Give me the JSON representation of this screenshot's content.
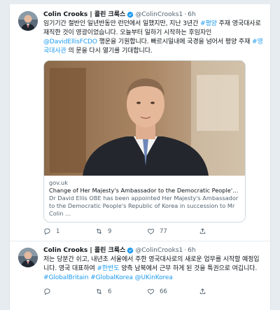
{
  "tweets": [
    {
      "name": "Colin Crooks | 콜린 크룩스",
      "handle": "@ColinCrooks1",
      "separator": "·",
      "time": "6h",
      "text_parts": [
        {
          "t": "임기기간 절반인 일년반동안 런던에서 일했지만, 지난 3년간 ",
          "link": false
        },
        {
          "t": "#평양",
          "link": true
        },
        {
          "t": " 주재 영국대사로 재직한 것이 영광이었습니다. 오늘부터 일하기 시작하는 후임자인 ",
          "link": false
        },
        {
          "t": "@DavidEllisFCDO",
          "link": true
        },
        {
          "t": " 행운을 기원합니다. 빠르시일내에 국경을 넘어서 평양 주재 ",
          "link": false
        },
        {
          "t": "#영국대사관",
          "link": true
        },
        {
          "t": " 의 문을 다시 열기를 기대합니다.",
          "link": false
        }
      ],
      "card": {
        "domain": "gov.uk",
        "title": "Change of Her Majesty's Ambassador to the Democratic People's Rep…",
        "description": "Dr David Ellis OBE has been appointed Her Majesty's Ambassador to the Democratic People's Republic of Korea in succession to Mr Colin …"
      },
      "actions": {
        "replies": "1",
        "retweets": "9",
        "likes": "77"
      }
    },
    {
      "name": "Colin Crooks | 콜린 크룩스",
      "handle": "@ColinCrooks1",
      "separator": "·",
      "time": "6h",
      "text_parts": [
        {
          "t": "저는 당분간 쉬고, 내년초 서울에서 주한 영국대사로의 새로운 업무를 시작할 예정입니다. 영국 대표하여 ",
          "link": false
        },
        {
          "t": "#한반도",
          "link": true
        },
        {
          "t": " 양측 남북에서 근무 하게 된 것을 특권으로 여깁니다. ",
          "link": false
        },
        {
          "t": "#GlobalBritain #GlobalKorea @UKinKorea",
          "link": true
        }
      ],
      "actions": {
        "replies": "",
        "retweets": "6",
        "likes": "66"
      }
    }
  ],
  "icons": [
    "verified-badge-icon",
    "reply-icon",
    "retweet-icon",
    "like-icon",
    "share-icon"
  ],
  "colors": {
    "link": "#1d9bf0",
    "muted": "#536471",
    "text": "#0f1419",
    "border": "#cfd9de",
    "background": "#e6ecf0"
  }
}
